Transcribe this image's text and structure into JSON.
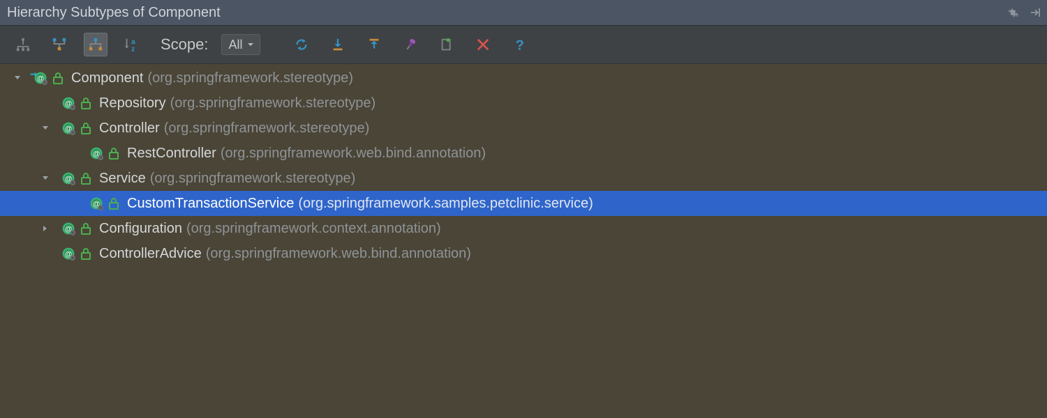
{
  "titlebar": {
    "title": "Hierarchy Subtypes of Component"
  },
  "toolbar": {
    "scope_label": "Scope:",
    "scope_value": "All"
  },
  "tree": [
    {
      "indent": 0,
      "arrow_state": "expanded",
      "root_marker": true,
      "name": "Component",
      "pkg": "org.springframework.stereotype",
      "selected": false
    },
    {
      "indent": 1,
      "arrow_state": "none",
      "root_marker": false,
      "name": "Repository",
      "pkg": "org.springframework.stereotype",
      "selected": false
    },
    {
      "indent": 1,
      "arrow_state": "expanded",
      "root_marker": false,
      "name": "Controller",
      "pkg": "org.springframework.stereotype",
      "selected": false
    },
    {
      "indent": 2,
      "arrow_state": "none",
      "root_marker": false,
      "name": "RestController",
      "pkg": "org.springframework.web.bind.annotation",
      "selected": false
    },
    {
      "indent": 1,
      "arrow_state": "expanded",
      "root_marker": false,
      "name": "Service",
      "pkg": "org.springframework.stereotype",
      "selected": false
    },
    {
      "indent": 2,
      "arrow_state": "none",
      "root_marker": false,
      "name": "CustomTransactionService",
      "pkg": "org.springframework.samples.petclinic.service",
      "selected": true
    },
    {
      "indent": 1,
      "arrow_state": "collapsed",
      "root_marker": false,
      "name": "Configuration",
      "pkg": "org.springframework.context.annotation",
      "selected": false
    },
    {
      "indent": 1,
      "arrow_state": "none",
      "root_marker": false,
      "name": "ControllerAdvice",
      "pkg": "org.springframework.web.bind.annotation",
      "selected": false
    }
  ]
}
